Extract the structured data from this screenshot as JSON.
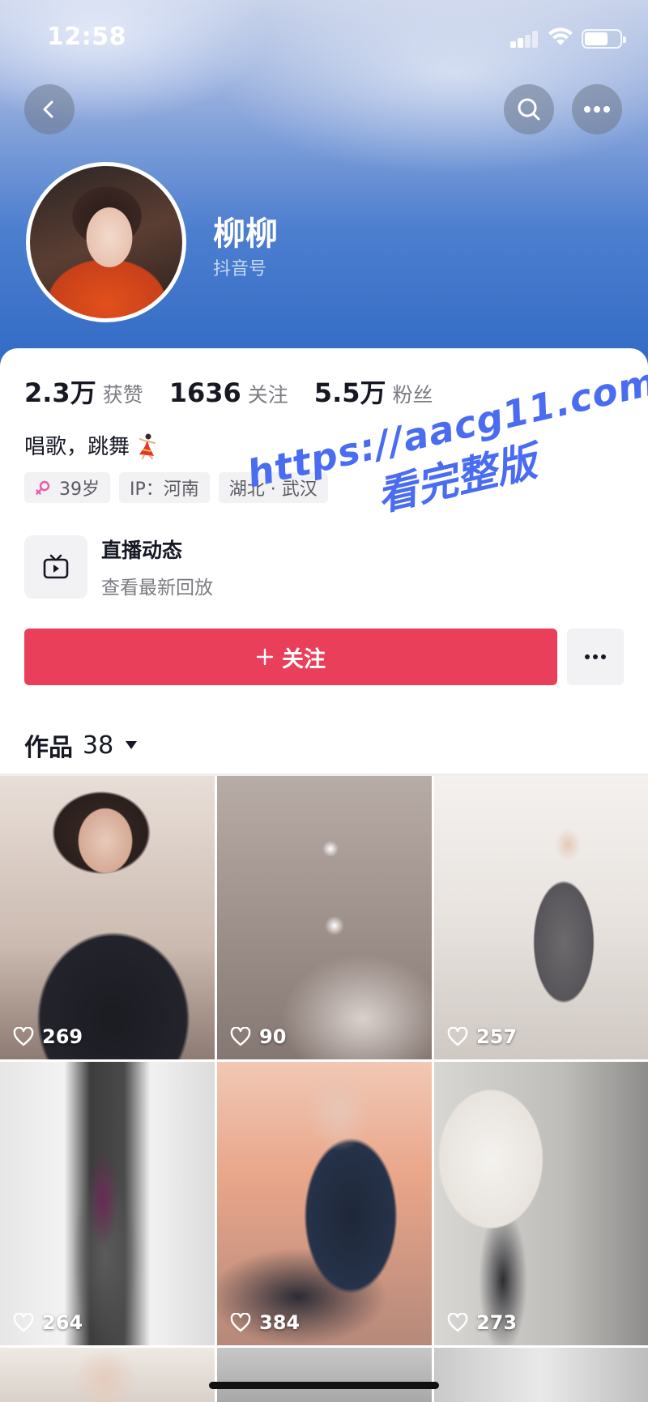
{
  "status_bar": {
    "time": "12:58"
  },
  "profile": {
    "name": "柳柳",
    "account_prefix": "抖音号"
  },
  "stats": [
    {
      "value": "2.3万",
      "label": "获赞"
    },
    {
      "value": "1636",
      "label": "关注"
    },
    {
      "value": "5.5万",
      "label": "粉丝"
    }
  ],
  "bio": {
    "text": "唱歌，跳舞",
    "emoji": "dancer-icon"
  },
  "tags": {
    "age": "39岁",
    "ip": "IP：河南",
    "location": "湖北 · 武汉"
  },
  "live": {
    "title": "直播动态",
    "subtitle": "查看最新回放"
  },
  "follow_button": {
    "label": "关注"
  },
  "works": {
    "label": "作品",
    "count": "38"
  },
  "watermark": {
    "url": "https://aacg11.com",
    "text": "看完整版"
  },
  "videos": [
    {
      "likes": "269"
    },
    {
      "likes": "90"
    },
    {
      "likes": "257"
    },
    {
      "likes": "264"
    },
    {
      "likes": "384"
    },
    {
      "likes": "273"
    }
  ],
  "colors": {
    "follow_accent": "#ea3f5b",
    "watermark": "#4a6cf0",
    "female_icon": "#e85ca8"
  }
}
